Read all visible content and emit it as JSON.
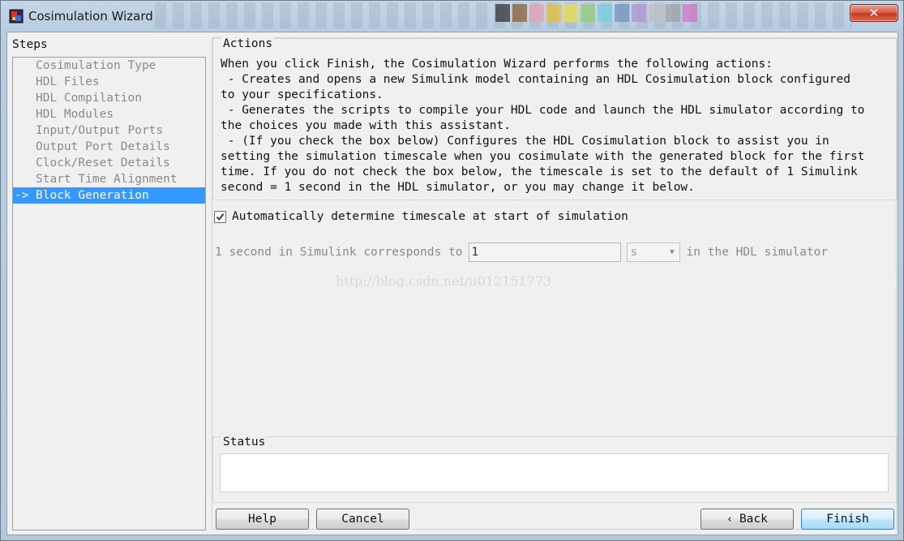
{
  "window": {
    "title": "Cosimulation Wizard",
    "close_glyph": "✕"
  },
  "steps": {
    "label": "Steps",
    "items": [
      {
        "label": "Cosimulation Type"
      },
      {
        "label": "HDL Files"
      },
      {
        "label": "HDL Compilation"
      },
      {
        "label": "HDL Modules"
      },
      {
        "label": "Input/Output Ports"
      },
      {
        "label": "Output Port Details"
      },
      {
        "label": "Clock/Reset Details"
      },
      {
        "label": "Start Time Alignment"
      },
      {
        "label": "Block Generation",
        "marker": "->",
        "selected": true
      }
    ]
  },
  "actions": {
    "title": "Actions",
    "text": "When you click Finish, the Cosimulation Wizard performs the following actions:\n - Creates and opens a new Simulink model containing an HDL Cosimulation block configured\nto your specifications.\n - Generates the scripts to compile your HDL code and launch the HDL simulator according to\nthe choices you made with this assistant.\n - (If you check the box below) Configures the HDL Cosimulation block to assist you in\nsetting the simulation timescale when you cosimulate with the generated block for the first\ntime. If you do not check the box below, the timescale is set to the default of 1 Simulink\nsecond = 1 second in the HDL simulator, or you may change it below."
  },
  "auto_timescale": {
    "label": "Automatically determine timescale at start of simulation",
    "checked": true
  },
  "timescale": {
    "prefix": "1 second in Simulink corresponds to",
    "value": "1",
    "unit": "s",
    "suffix": "in the HDL simulator"
  },
  "watermark": "http://blog.csdn.net/u012151773",
  "status": {
    "title": "Status",
    "text": ""
  },
  "buttons": {
    "help": "Help",
    "cancel": "Cancel",
    "back": "Back",
    "finish": "Finish"
  },
  "colors": {
    "selection": "#3399ff",
    "close_button": "#c23b22"
  }
}
